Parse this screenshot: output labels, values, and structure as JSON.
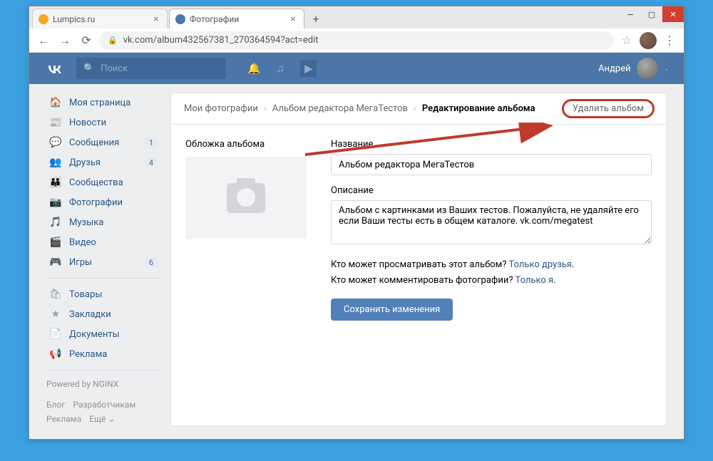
{
  "browser": {
    "tabs": [
      {
        "title": "Lumpics.ru",
        "favicon": "#f5a623"
      },
      {
        "title": "Фотографии",
        "favicon": "#4a76a8"
      }
    ],
    "url": "vk.com/album432567381_270364594?act=edit"
  },
  "header": {
    "search_placeholder": "Поиск",
    "username": "Андрей"
  },
  "sidebar": {
    "items": [
      {
        "icon": "🏠",
        "label": "Моя страница",
        "badge": ""
      },
      {
        "icon": "📰",
        "label": "Новости",
        "badge": ""
      },
      {
        "icon": "💬",
        "label": "Сообщения",
        "badge": "1"
      },
      {
        "icon": "👥",
        "label": "Друзья",
        "badge": "4"
      },
      {
        "icon": "👪",
        "label": "Сообщества",
        "badge": ""
      },
      {
        "icon": "📷",
        "label": "Фотографии",
        "badge": ""
      },
      {
        "icon": "🎵",
        "label": "Музыка",
        "badge": ""
      },
      {
        "icon": "🎬",
        "label": "Видео",
        "badge": ""
      },
      {
        "icon": "🎮",
        "label": "Игры",
        "badge": "6"
      }
    ],
    "items2": [
      {
        "icon": "🛍",
        "label": "Товары"
      },
      {
        "icon": "★",
        "label": "Закладки"
      },
      {
        "icon": "📄",
        "label": "Документы"
      },
      {
        "icon": "📢",
        "label": "Реклама"
      }
    ],
    "powered": "Powered by NGINX",
    "footer": {
      "blog": "Блог",
      "devs": "Разработчикам",
      "ads": "Реклама",
      "more": "Ещё ⌄"
    }
  },
  "breadcrumb": {
    "photos": "Мои фотографии",
    "album": "Альбом редактора МегаТестов",
    "current": "Редактирование альбома",
    "delete": "Удалить альбом"
  },
  "form": {
    "cover_label": "Обложка альбома",
    "name_label": "Название",
    "name_value": "Альбом редактора МегаТестов",
    "desc_label": "Описание",
    "desc_value": "Альбом с картинками из Ваших тестов. Пожалуйста, не удаляйте его если Ваши тесты есть в общем каталоге. vk.com/megatest",
    "privacy_view_q": "Кто может просматривать этот альбом? ",
    "privacy_view_a": "Только друзья",
    "privacy_comment_q": "Кто может комментировать фотографии? ",
    "privacy_comment_a": "Только я",
    "save": "Сохранить изменения"
  }
}
